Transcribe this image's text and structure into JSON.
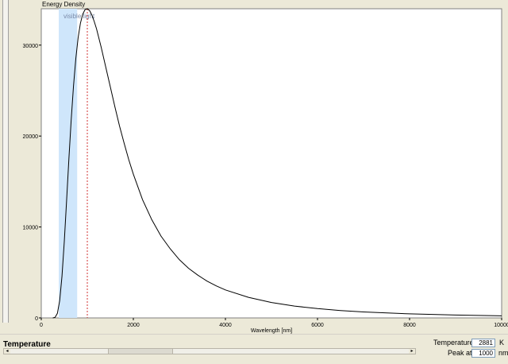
{
  "controls": {
    "section_title": "Temperature",
    "temperature": {
      "label": "Temperature",
      "value": "2881",
      "unit": "K"
    },
    "peak": {
      "label": "Peak at",
      "value": "1000",
      "unit": "nm"
    },
    "temperature_slider": {
      "position": 0.29
    }
  },
  "chart_data": {
    "type": "line",
    "ylabel": "Energy Density",
    "xlabel": "Wavelength [nm]",
    "xlim": [
      0,
      10000
    ],
    "ylim": [
      0,
      34000
    ],
    "xticks": [
      0,
      2000,
      4000,
      6000,
      8000,
      10000
    ],
    "yticks": [
      0,
      10000,
      20000,
      30000
    ],
    "band": {
      "label": "visible light",
      "from": 380,
      "to": 780,
      "color": "#cfe6fb"
    },
    "marker": {
      "x": 1000,
      "color": "#d03030",
      "style": "dashed"
    },
    "series": [
      {
        "color": "#000000",
        "x": [
          250,
          300,
          350,
          400,
          450,
          500,
          550,
          600,
          650,
          700,
          750,
          800,
          850,
          900,
          950,
          1000,
          1050,
          1100,
          1150,
          1200,
          1300,
          1400,
          1500,
          1600,
          1700,
          1800,
          1900,
          2000,
          2200,
          2400,
          2600,
          2800,
          3000,
          3200,
          3400,
          3600,
          3800,
          4000,
          4500,
          5000,
          5500,
          6000,
          6500,
          7000,
          8000,
          9000,
          10000
        ],
        "values": [
          2,
          60,
          500,
          1900,
          4600,
          8400,
          12900,
          17500,
          21800,
          25500,
          28500,
          30800,
          32400,
          33400,
          33900,
          34000,
          33800,
          33300,
          32600,
          31800,
          29800,
          27600,
          25400,
          23200,
          21100,
          19200,
          17400,
          15800,
          13000,
          10800,
          9000,
          7600,
          6400,
          5450,
          4700,
          4050,
          3520,
          3080,
          2260,
          1700,
          1300,
          1020,
          810,
          655,
          445,
          315,
          230
        ]
      }
    ]
  }
}
